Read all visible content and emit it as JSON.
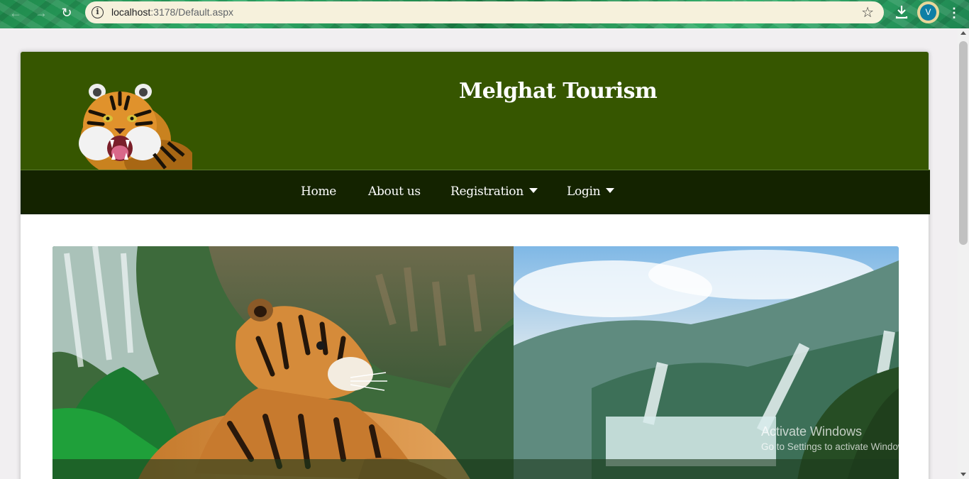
{
  "browser": {
    "url_host": "localhost",
    "url_path": ":3178/Default.aspx",
    "avatar_initial": "V",
    "icons": [
      "back-icon",
      "forward-icon",
      "reload-icon",
      "info-icon",
      "star-icon",
      "download-icon",
      "menu-icon"
    ]
  },
  "site": {
    "title": "Melghat Tourism",
    "colors": {
      "header": "#365600",
      "navbar": "#142300"
    }
  },
  "nav": {
    "home": "Home",
    "about": "About us",
    "registration": "Registration",
    "login": "Login"
  },
  "watermark": {
    "title": "Activate Windows",
    "subtitle": "Go to Settings to activate Windows."
  }
}
